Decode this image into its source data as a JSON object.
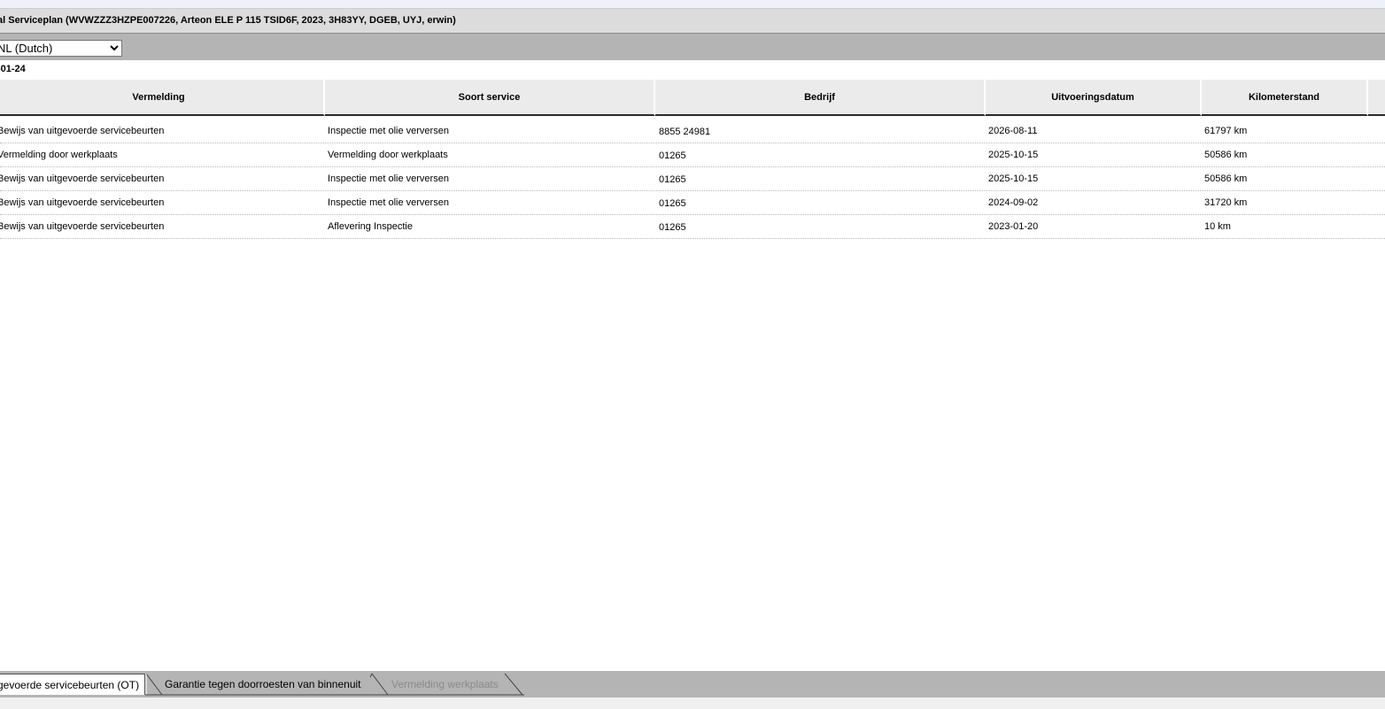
{
  "window": {
    "title": "al Serviceplan (WVWZZZ3HZPE007226, Arteon ELE P 115 TSID6F, 2023, 3H83YY, DGEB, UYJ, erwin)"
  },
  "language_select": {
    "selected": "NL (Dutch)"
  },
  "header_date": "-01-24",
  "table": {
    "columns": [
      "Vermelding",
      "Soort service",
      "Bedrijf",
      "Uitvoeringsdatum",
      "Kilometerstand"
    ],
    "rows": [
      [
        "Bewijs van uitgevoerde servicebeurten",
        "Inspectie met olie verversen",
        "8855 24981",
        "2026-08-11",
        "61797 km"
      ],
      [
        "Vermelding door werkplaats",
        "Vermelding door werkplaats",
        "01265",
        "2025-10-15",
        "50586 km"
      ],
      [
        "Bewijs van uitgevoerde servicebeurten",
        "Inspectie met olie verversen",
        "01265",
        "2025-10-15",
        "50586 km"
      ],
      [
        "Bewijs van uitgevoerde servicebeurten",
        "Inspectie met olie verversen",
        "01265",
        "2024-09-02",
        "31720 km"
      ],
      [
        "Bewijs van uitgevoerde servicebeurten",
        "Aflevering Inspectie",
        "01265",
        "2023-01-20",
        "10 km"
      ]
    ]
  },
  "tabs": [
    {
      "label": "gevoerde servicebeurten (OT)",
      "state": "active"
    },
    {
      "label": "Garantie tegen doorroesten van binnenuit",
      "state": "inactive"
    },
    {
      "label": "Vermelding werkplaats",
      "state": "disabled"
    }
  ]
}
